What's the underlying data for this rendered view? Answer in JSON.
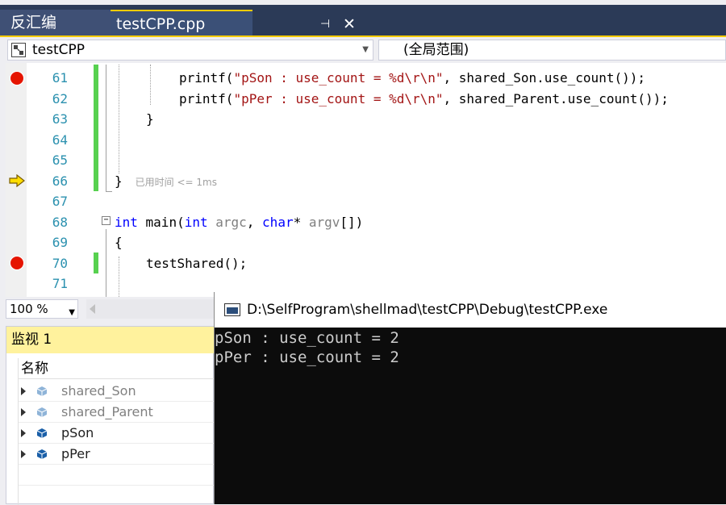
{
  "tabs": {
    "disassembly": "反汇编",
    "active_file": "testCPP.cpp",
    "pin_glyph": "⊣",
    "close_glyph": "✕"
  },
  "navbar": {
    "project": "testCPP",
    "scope": "(全局范围)"
  },
  "editor": {
    "line_numbers": [
      "61",
      "62",
      "63",
      "64",
      "65",
      "66",
      "67",
      "68",
      "69",
      "70",
      "71"
    ],
    "lines": {
      "l61": {
        "fn": "printf(",
        "str": "\"pSon : use_count = %d\\r\\n\"",
        "rest": ", shared_Son.use_count());"
      },
      "l62": {
        "fn": "printf(",
        "str": "\"pPer : use_count = %d\\r\\n\"",
        "rest": ", shared_Parent.use_count());"
      },
      "l63": "}",
      "l66": "}",
      "l68_kw1": "int",
      "l68_fn": " main(",
      "l68_kw2": "int",
      "l68_p1": " argc",
      "l68_sep": ", ",
      "l68_kw3": "char",
      "l68_star": "* ",
      "l68_p2": "argv",
      "l68_end": "[])",
      "l69": "{",
      "l70": "testShared();"
    },
    "elapsed": "已用时间 <= 1ms",
    "collapse_glyph": "−",
    "zoom": "100 %",
    "breakpoint_lines": [
      "61",
      "70"
    ],
    "current_line": "66"
  },
  "watch": {
    "title": "监视 1",
    "column_name": "名称",
    "rows": [
      {
        "name": "shared_Son",
        "color": "#808080"
      },
      {
        "name": "shared_Parent",
        "color": "#808080"
      },
      {
        "name": "pSon",
        "color": "#1e1e1e"
      },
      {
        "name": "pPer",
        "color": "#1e1e1e"
      }
    ]
  },
  "console": {
    "title": "D:\\SelfProgram\\shellmad\\testCPP\\Debug\\testCPP.exe",
    "output": [
      "pSon : use_count = 2",
      "pPer : use_count = 2"
    ]
  },
  "colors": {
    "tab_bar": "#2b3a57",
    "active_tab_accent": "#ffcc00",
    "breakpoint": "#e51400",
    "line_number": "#2b91af",
    "keyword": "#0000ff",
    "string": "#a31515",
    "change_bar": "#57d14f",
    "watch_title_bg": "#fff29d",
    "console_bg": "#0c0c0c"
  }
}
